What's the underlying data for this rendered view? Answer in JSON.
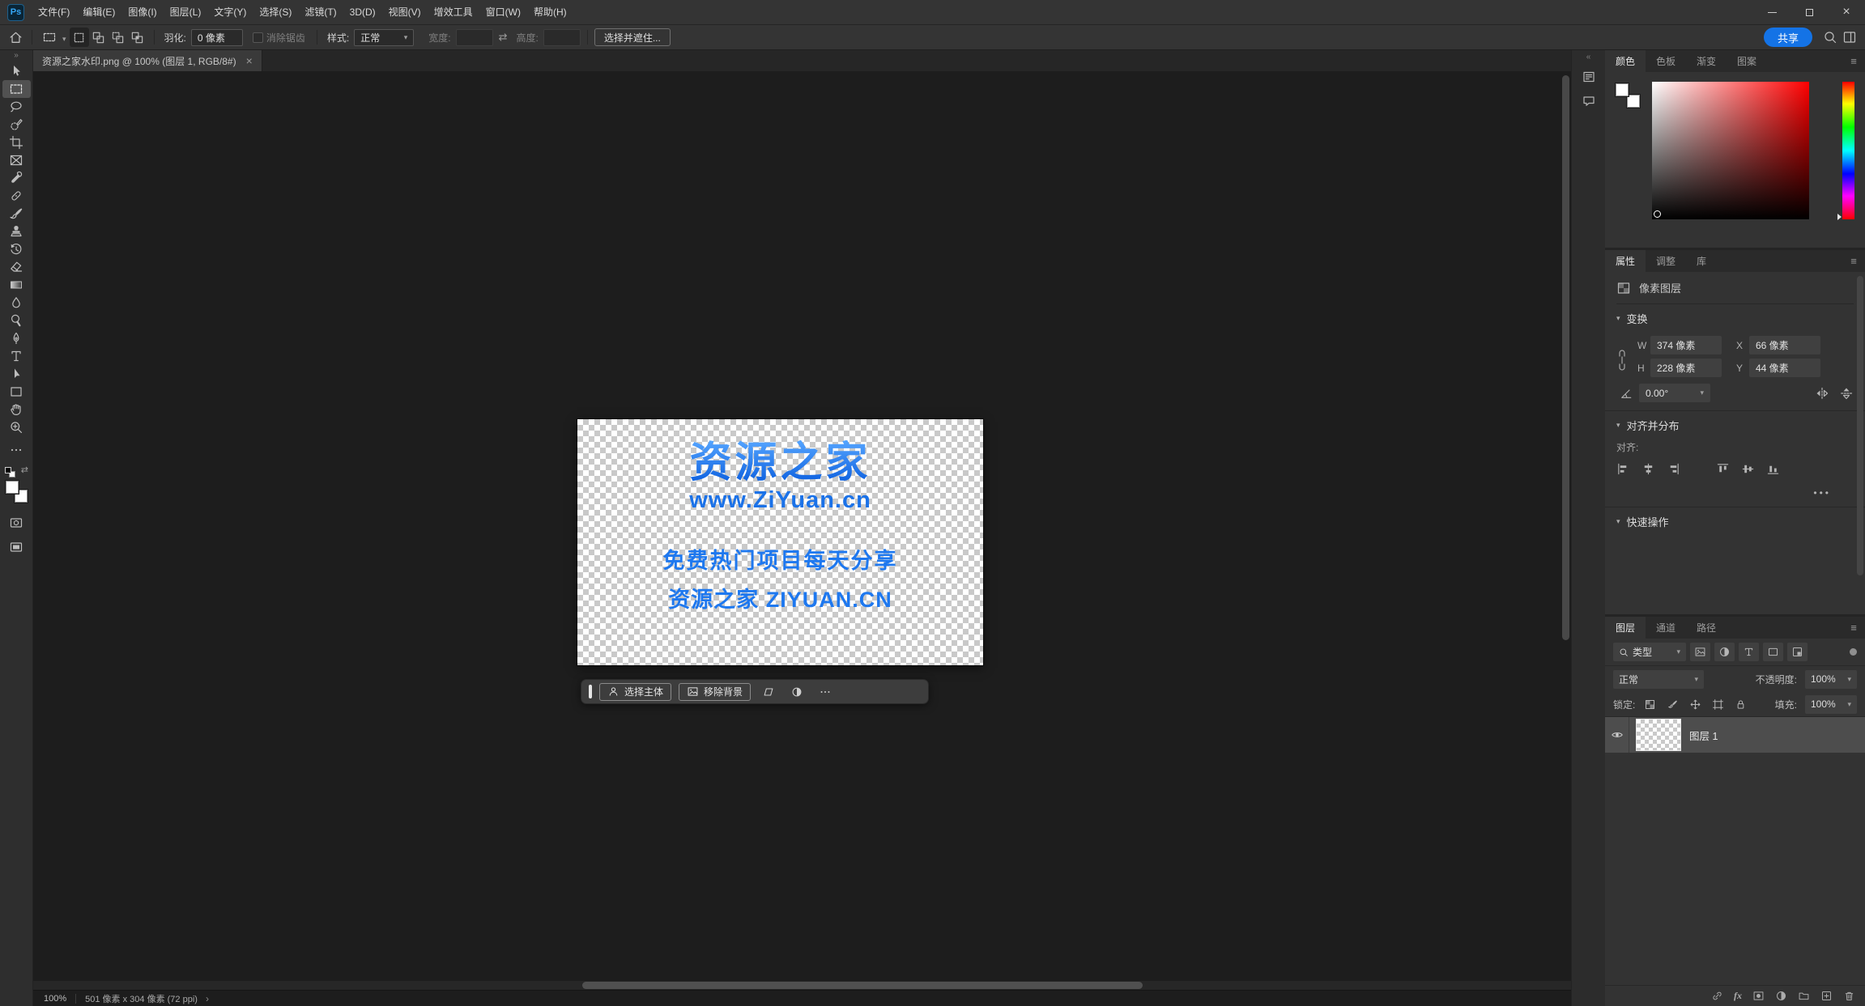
{
  "menubar": {
    "logo": "Ps",
    "items": [
      "文件(F)",
      "编辑(E)",
      "图像(I)",
      "图层(L)",
      "文字(Y)",
      "选择(S)",
      "滤镜(T)",
      "3D(D)",
      "视图(V)",
      "增效工具",
      "窗口(W)",
      "帮助(H)"
    ]
  },
  "options_bar": {
    "feather_label": "羽化:",
    "feather_value": "0 像素",
    "antialias_label": "消除锯齿",
    "style_label": "样式:",
    "style_value": "正常",
    "width_label": "宽度:",
    "height_label": "高度:",
    "select_and_mask_label": "选择并遮住...",
    "share_label": "共享"
  },
  "document": {
    "tab_title": "资源之家水印.png @ 100% (图层 1, RGB/8#)",
    "watermark": {
      "line1": "资源之家",
      "line2": "www.ZiYuan.cn",
      "line3": "免费热门项目每天分享",
      "line4": "资源之家 ZIYUAN.CN"
    }
  },
  "context_taskbar": {
    "select_subject_label": "选择主体",
    "remove_background_label": "移除背景"
  },
  "color_panel": {
    "tabs": [
      "颜色",
      "色板",
      "渐变",
      "图案"
    ]
  },
  "properties_panel": {
    "tabs": [
      "属性",
      "调整",
      "库"
    ],
    "layer_type_label": "像素图层",
    "transform": {
      "title": "变换",
      "w_label": "W",
      "w_value": "374 像素",
      "x_label": "X",
      "x_value": "66 像素",
      "h_label": "H",
      "h_value": "228 像素",
      "y_label": "Y",
      "y_value": "44 像素",
      "angle_value": "0.00°"
    },
    "align": {
      "title": "对齐并分布",
      "align_label": "对齐:"
    },
    "quick_actions_title": "快速操作"
  },
  "layers_panel": {
    "tabs": [
      "图层",
      "通道",
      "路径"
    ],
    "filter_type_label": "类型",
    "blend_mode_value": "正常",
    "opacity_label": "不透明度:",
    "opacity_value": "100%",
    "lock_label": "锁定:",
    "fill_label": "填充:",
    "fill_value": "100%",
    "fx_label": "fx",
    "rows": [
      {
        "name": "图层 1"
      }
    ]
  },
  "status_bar": {
    "zoom": "100%",
    "doc_size": "501 像素 x 304 像素 (72 ppi)"
  },
  "colors": {
    "accent_blue": "#1473e6",
    "watermark_blue": "#1b72e8"
  }
}
